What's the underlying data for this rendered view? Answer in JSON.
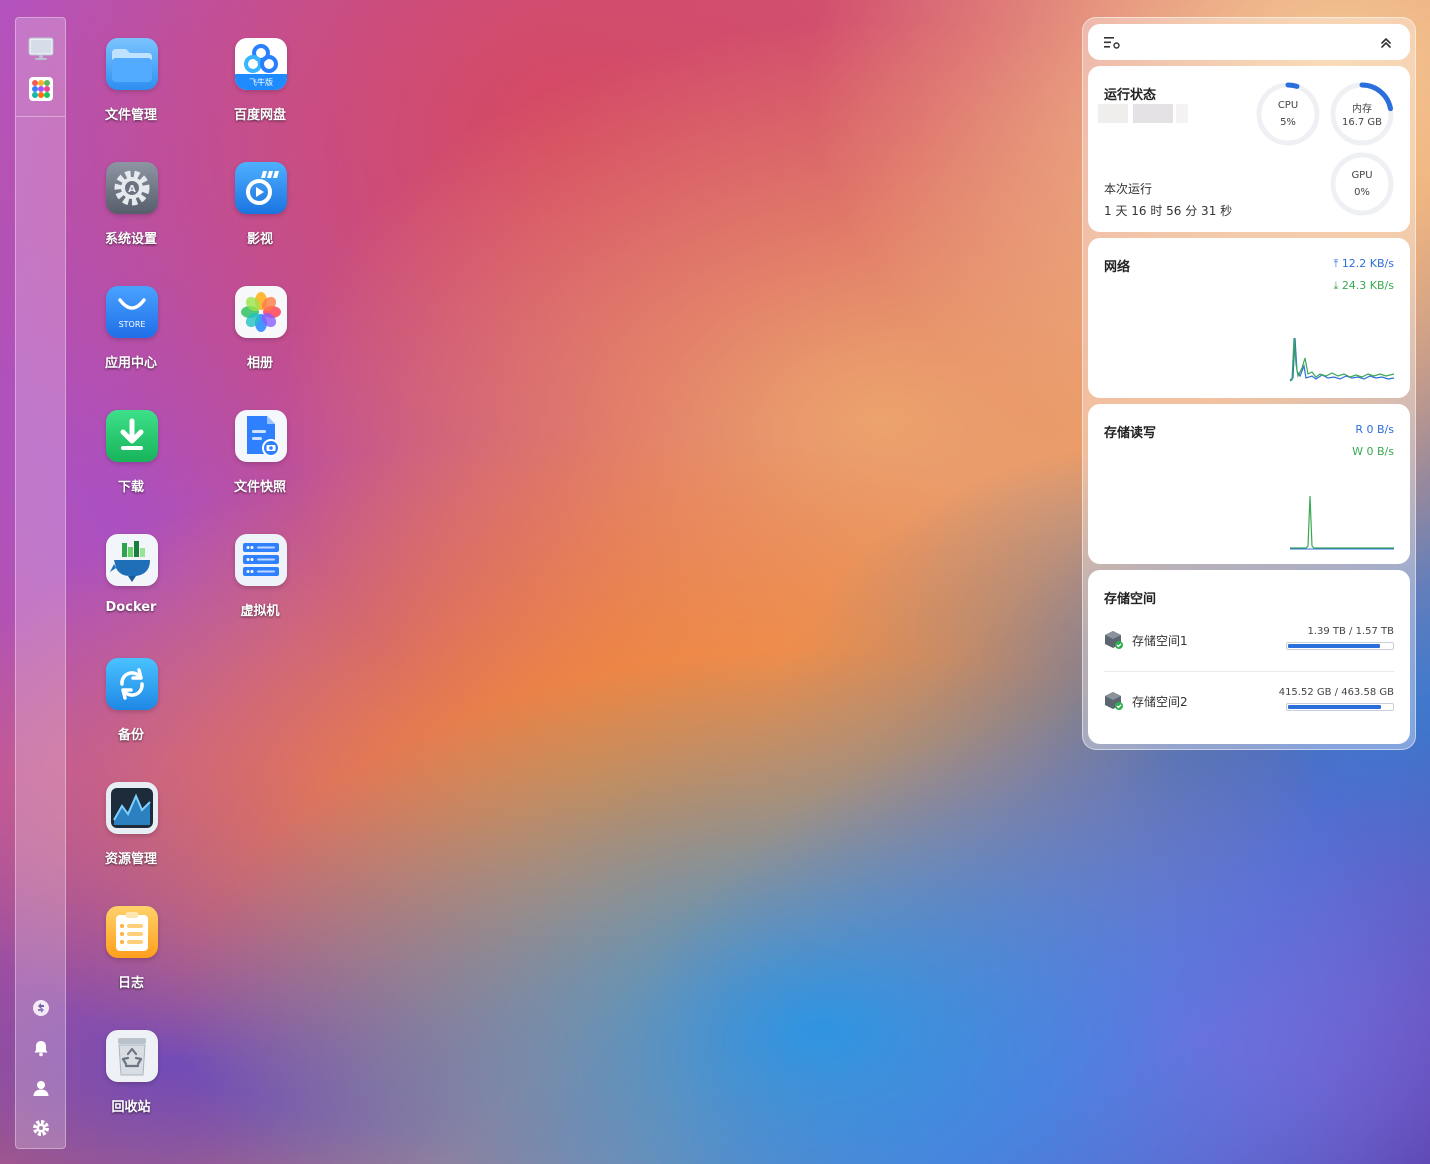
{
  "desktop": {
    "apps": [
      {
        "id": "files",
        "label": "文件管理",
        "icon": "folder-icon"
      },
      {
        "id": "baidu",
        "label": "百度网盘",
        "icon": "baidu-netdisk-icon",
        "badge": "飞牛版"
      },
      {
        "id": "settings",
        "label": "系统设置",
        "icon": "gear-icon"
      },
      {
        "id": "video",
        "label": "影视",
        "icon": "video-play-icon"
      },
      {
        "id": "store",
        "label": "应用中心",
        "icon": "store-bag-icon",
        "badge": "STORE"
      },
      {
        "id": "photos",
        "label": "相册",
        "icon": "photos-flower-icon"
      },
      {
        "id": "download",
        "label": "下载",
        "icon": "download-arrow-icon"
      },
      {
        "id": "snapshot",
        "label": "文件快照",
        "icon": "file-snapshot-icon"
      },
      {
        "id": "docker",
        "label": "Docker",
        "icon": "docker-whale-icon"
      },
      {
        "id": "vm",
        "label": "虚拟机",
        "icon": "server-rack-icon"
      },
      {
        "id": "backup",
        "label": "备份",
        "icon": "backup-sync-icon"
      },
      {
        "id": "monitor",
        "label": "资源管理",
        "icon": "resource-monitor-icon"
      },
      {
        "id": "logs",
        "label": "日志",
        "icon": "clipboard-list-icon"
      },
      {
        "id": "recycle",
        "label": "回收站",
        "icon": "recycle-bin-icon"
      }
    ]
  },
  "sidebar": {
    "top": [
      "desktop-monitor-icon",
      "app-launcher-icon"
    ],
    "bottom": [
      "sync-icon",
      "bell-icon",
      "user-icon",
      "settings-gear-icon"
    ]
  },
  "widget": {
    "status": {
      "title": "运行状态",
      "uptime_label": "本次运行",
      "uptime_value": "1 天 16 时 56 分 31 秒",
      "gauges": {
        "cpu": {
          "name": "CPU",
          "value": "5%",
          "percent": 5
        },
        "mem": {
          "name": "内存",
          "value": "16.7 GB",
          "percent": 22
        },
        "gpu": {
          "name": "GPU",
          "value": "0%",
          "percent": 0
        }
      }
    },
    "network": {
      "title": "网络",
      "upload": "12.2 KB/s",
      "download": "24.3 KB/s"
    },
    "io": {
      "title": "存储读写",
      "read": "R  0 B/s",
      "write": "W  0 B/s"
    },
    "storage": {
      "title": "存储空间",
      "volumes": [
        {
          "name": "存储空间1",
          "capacity": "1.39 TB / 1.57 TB",
          "used_fraction": 0.885
        },
        {
          "name": "存储空间2",
          "capacity": "415.52 GB / 463.58 GB",
          "used_fraction": 0.896
        }
      ]
    }
  },
  "colors": {
    "accent": "#2a6fdb",
    "upload": "#2e6fd9",
    "download": "#3aa852"
  }
}
